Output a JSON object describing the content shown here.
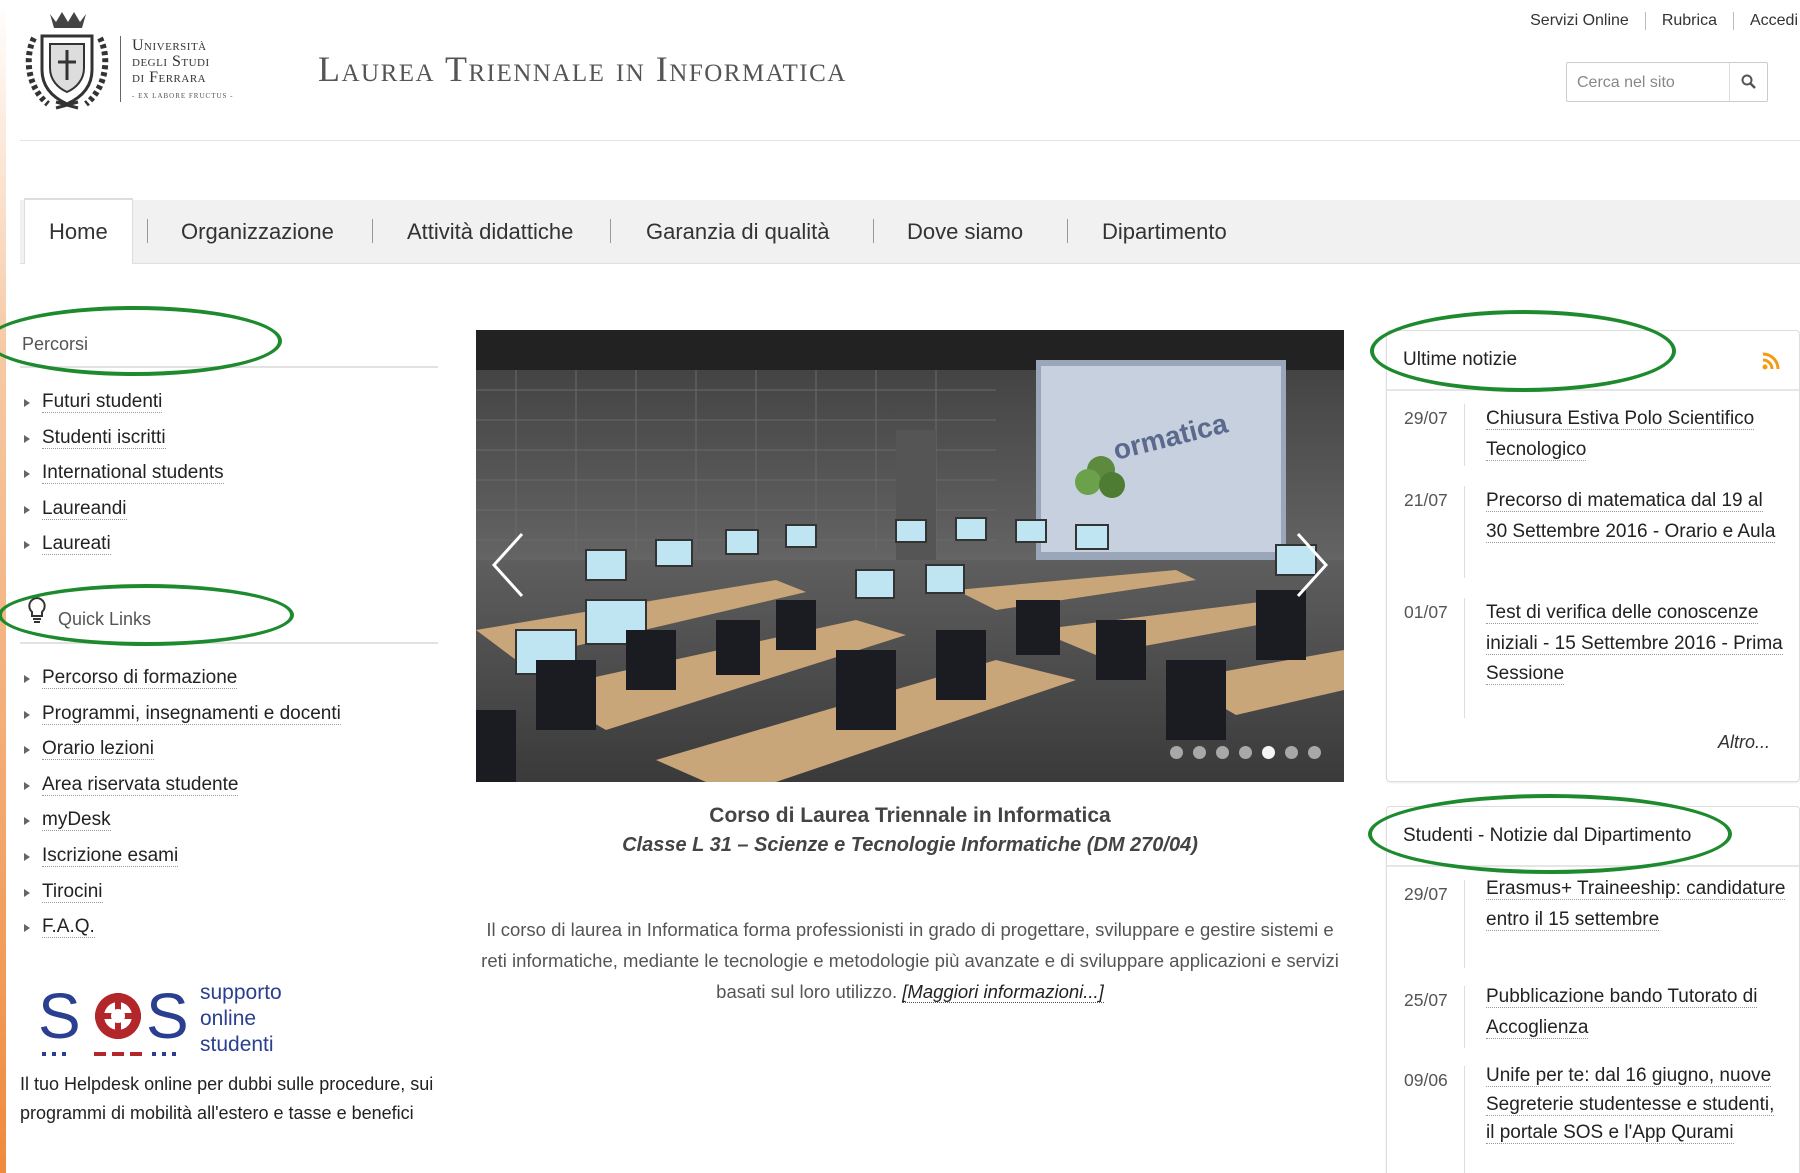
{
  "header": {
    "university_lines": [
      "Università",
      "degli Studi",
      "di Ferrara"
    ],
    "university_motto": "- EX LABORE FRUCTUS -",
    "site_title": "Laurea Triennale in Informatica",
    "top_links": [
      "Servizi Online",
      "Rubrica",
      "Accedi"
    ],
    "search_placeholder": "Cerca nel sito"
  },
  "nav": {
    "items": [
      "Home",
      "Organizzazione",
      "Attività didattiche",
      "Garanzia di qualità",
      "Dove siamo",
      "Dipartimento"
    ],
    "active": "Home"
  },
  "sidebar": {
    "percorsi_title": "Percorsi",
    "percorsi": [
      "Futuri studenti",
      "Studenti iscritti",
      "International students",
      "Laureandi",
      "Laureati"
    ],
    "quick_links_title": "Quick Links",
    "quick_links": [
      "Percorso di formazione",
      "Programmi, insegnamenti e docenti",
      "Orario lezioni",
      "Area riservata studente",
      "myDesk",
      "Iscrizione esami",
      "Tirocini",
      "F.A.Q."
    ],
    "sos": {
      "logo_text": "SOS",
      "lines": [
        "supporto",
        "online",
        "studenti"
      ],
      "description": "Il tuo Helpdesk online per dubbi sulle procedure, sui programmi di mobilità all'estero e tasse e benefici"
    }
  },
  "main": {
    "slider_dots": 7,
    "slider_active_dot": 4,
    "caption_title": "Corso di Laurea Triennale in Informatica",
    "caption_subtitle": "Classe L 31 – Scienze e Tecnologie Informatiche (DM 270/04)",
    "intro_text": "Il corso di laurea in Informatica forma professionisti in grado di progettare, sviluppare e gestire sistemi e reti informatiche, mediante le tecnologie e metodologie più avanzate e di sviluppare applicazioni e servizi basati sul loro utilizzo.",
    "intro_link": "[Maggiori informazioni...]"
  },
  "right": {
    "ultime_notizie": {
      "title": "Ultime notizie",
      "items": [
        {
          "date": "29/07",
          "text": "Chiusura Estiva Polo Scientifico Tecnologico"
        },
        {
          "date": "21/07",
          "text": "Precorso di matematica dal 19 al 30 Settembre 2016 - Orario e Aula"
        },
        {
          "date": "01/07",
          "text": "Test di verifica delle conoscenze iniziali - 15 Settembre 2016 - Prima Sessione"
        }
      ],
      "more": "Altro..."
    },
    "studenti_notizie": {
      "title": "Studenti - Notizie dal Dipartimento",
      "items": [
        {
          "date": "29/07",
          "text": "Erasmus+ Traineeship: candidature entro il 15 settembre"
        },
        {
          "date": "25/07",
          "text": "Pubblicazione bando Tutorato di Accoglienza"
        },
        {
          "date": "09/06",
          "text": "Unife per te: dal 16 giugno, nuove Segreterie studentesse e studenti, il portale SOS e l'App Qurami"
        }
      ]
    }
  },
  "colors": {
    "highlight_ellipse": "#1e8a2e",
    "rss": "#f39c12",
    "sos_blue": "#2a3f8f",
    "sos_red": "#b3262a"
  }
}
